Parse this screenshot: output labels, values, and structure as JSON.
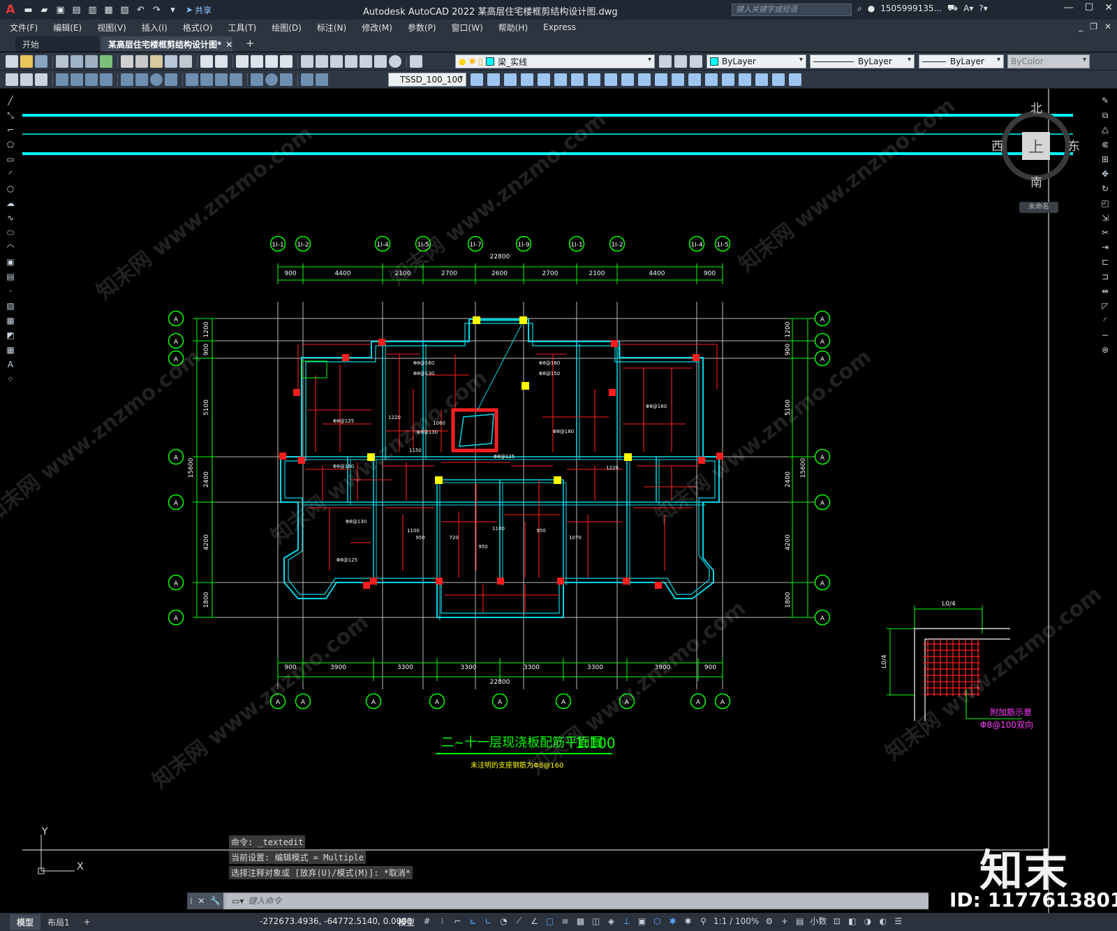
{
  "app": {
    "logo": "A",
    "title": "Autodesk AutoCAD 2022    某高层住宅楼框剪结构设计图.dwg",
    "share_label": "共享",
    "search_placeholder": "键入关键字或短语",
    "user": "1505999135...",
    "accent": "#e0393e"
  },
  "menu": [
    "文件(F)",
    "编辑(E)",
    "视图(V)",
    "插入(I)",
    "格式(O)",
    "工具(T)",
    "绘图(D)",
    "标注(N)",
    "修改(M)",
    "参数(P)",
    "窗口(W)",
    "帮助(H)",
    "Express"
  ],
  "tabs": {
    "start": "开始",
    "doc": "某高层住宅楼框剪结构设计图*",
    "close": "✕",
    "add": "+"
  },
  "toolbar": {
    "layer_name": "梁_实线",
    "layer_color": "#00ffff",
    "color_value": "ByLayer",
    "linetype_value": "ByLayer",
    "lineweight_value": "ByLayer",
    "plotstyle_value": "ByColor",
    "dimstyle_value": "TSSD_100_100"
  },
  "viewcube": {
    "north": "北",
    "south": "南",
    "east": "东",
    "west": "西",
    "top": "上",
    "wcs": "未命名"
  },
  "drawing": {
    "title": "二~十一层现浇板配筋平面图",
    "scale": "1:100",
    "note": "未注明的支座钢筋为Φ8@160",
    "top_total": "22800",
    "bottom_total": "22800",
    "top_dims": [
      "900",
      "4400",
      "2100",
      "2700",
      "2600",
      "2700",
      "2100",
      "4400",
      "900"
    ],
    "bottom_dims": [
      "900",
      "3900",
      "3300",
      "3300",
      "3300",
      "3300",
      "3900",
      "900"
    ],
    "left_dims": [
      "1200",
      "900",
      "5100",
      "2400",
      "4200",
      "1800"
    ],
    "left_total": "15600",
    "right_dims": [
      "1200",
      "900",
      "5100",
      "2400",
      "4200",
      "1800"
    ],
    "right_total": "15600",
    "top_axis_bubbles": [
      "1I-1",
      "1I-2",
      "1I-4",
      "1I-5",
      "1I-7",
      "1I-9",
      "1I-1",
      "1I-2",
      "1I-4",
      "1I-5"
    ],
    "bottom_axis_bubbles": [
      "A",
      "A",
      "A",
      "A",
      "A",
      "A",
      "A",
      "A",
      "A"
    ],
    "side_axis_bubbles": [
      "A",
      "A",
      "A",
      "A",
      "A",
      "A",
      "A"
    ],
    "rebar_labels": [
      "Φ8@180",
      "Φ8@130",
      "Φ8@125",
      "Φ8@160",
      "Φ8@130",
      "Φ8@180",
      "Φ8@150",
      "Φ8@125",
      "Φ8@160",
      "Φ8@130",
      "Φ8@180",
      "Φ8@125",
      "1220",
      "1060",
      "1150",
      "950",
      "720",
      "1100",
      "950",
      "1070",
      "1220",
      "950",
      "1100"
    ],
    "detail": {
      "label_top": "L0/4",
      "label_side": "L0/4",
      "title": "附加筋示意",
      "spec": "Φ8@100双向"
    }
  },
  "command": {
    "history": [
      "命令: _textedit",
      "当前设置: 编辑模式 = Multiple",
      "选择注释对象或 [放弃(U)/模式(M)]: *取消*"
    ],
    "placeholder": "键入命令"
  },
  "ucs": {
    "y": "Y",
    "x": "X"
  },
  "status": {
    "layout_tabs": [
      "模型",
      "布局1"
    ],
    "coords": "-272673.4936, -64772.5140, 0.0000",
    "model": "模型",
    "scale": "1:1 / 100%",
    "units": "小数"
  },
  "watermark": {
    "logo": "知末",
    "id": "ID: 1177613801",
    "site": "知末网 www.znzmo.com"
  }
}
